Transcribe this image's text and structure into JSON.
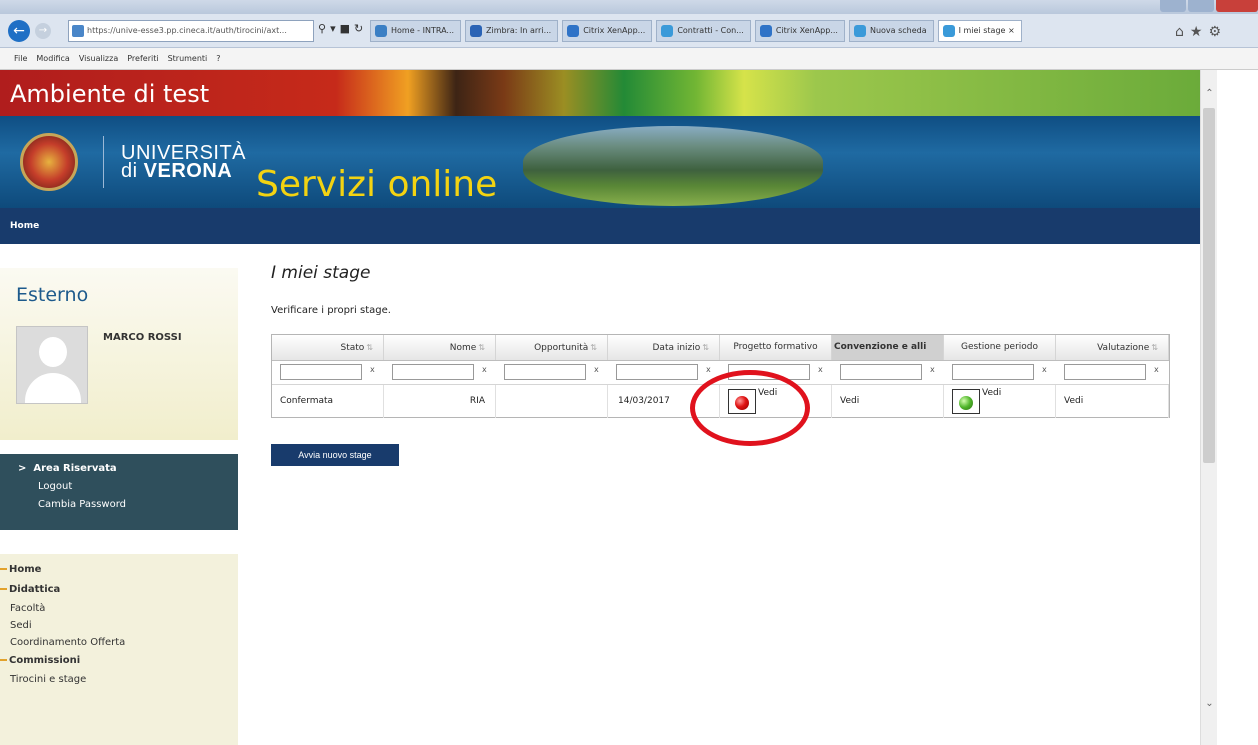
{
  "browser": {
    "address": "https://unive-esse3.pp.cineca.it/auth/tirocini/axt...",
    "tabs": [
      {
        "label": "Home - INTRA...",
        "color": "#3b7fc4"
      },
      {
        "label": "Zimbra: In arri...",
        "color": "#2a63b5"
      },
      {
        "label": "Citrix XenApp...",
        "color": "#2f73c7"
      },
      {
        "label": "Contratti - Con...",
        "color": "#3a9ad9"
      },
      {
        "label": "Citrix XenApp...",
        "color": "#2f73c7"
      },
      {
        "label": "Nuova scheda",
        "color": "#3a9ad9"
      },
      {
        "label": "I miei stage",
        "color": "#3a9ad9",
        "active": true
      }
    ],
    "menu": [
      "File",
      "Modifica",
      "Visualizza",
      "Preferiti",
      "Strumenti",
      "?"
    ]
  },
  "header": {
    "test_label": "Ambiente di test",
    "logo_line1": "UNIVERSITÀ",
    "logo_line2_prefix": "di",
    "logo_line2_bold": "VERONA",
    "servizi": "Servizi online",
    "home": "Home"
  },
  "sidebar": {
    "role": "Esterno",
    "user_name": "MARCO ROSSI",
    "area": {
      "title": "Area Riservata",
      "items": [
        "Logout",
        "Cambia Password"
      ]
    },
    "menu": [
      {
        "label": "Home",
        "type": "cat"
      },
      {
        "label": "Didattica",
        "type": "cat"
      },
      {
        "label": "Facoltà",
        "type": "sub"
      },
      {
        "label": "Sedi",
        "type": "sub"
      },
      {
        "label": "Coordinamento Offerta",
        "type": "sub"
      },
      {
        "label": "Commissioni",
        "type": "cat"
      },
      {
        "label": "Tirocini e stage",
        "type": "sub"
      }
    ]
  },
  "main": {
    "title": "I miei stage",
    "subtitle": "Verificare i propri stage.",
    "columns": [
      "Stato",
      "Nome",
      "Opportunità",
      "Data inizio",
      "Progetto formativo",
      "Convenzione e alli",
      "Gestione periodo",
      "Valutazione"
    ],
    "filter_clear": "x",
    "row": {
      "stato": "Confermata",
      "nome": "RIA",
      "opportunita": "",
      "data_inizio": "14/03/2017",
      "progetto": "Vedi",
      "convenzione": "Vedi",
      "gestione": "Vedi",
      "valutazione": "Vedi"
    },
    "new_button": "Avvia nuovo stage"
  },
  "colors": {
    "banner": "#0f4e83",
    "homebar": "#183b6c",
    "servizi_text": "#f3d312",
    "highlight": "#e0121d",
    "status_red": "#e01313",
    "status_green": "#4fb52a"
  }
}
